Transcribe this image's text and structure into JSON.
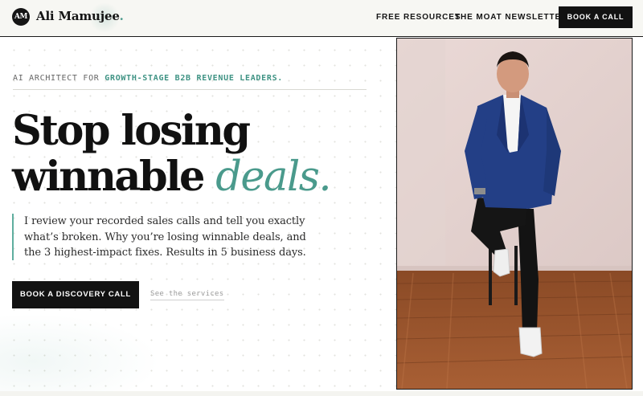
{
  "header": {
    "logo_mark": "AM",
    "logo_name": "Ali Mamujee",
    "logo_dot": ".",
    "nav": {
      "free_resources": "FREE RESOURCES",
      "moat_newsletter": "THE MOAT NEWSLETTER"
    },
    "cta_label": "BOOK A CALL"
  },
  "hero": {
    "eyebrow_prefix": "AI ARCHITECT FOR ",
    "eyebrow_accent": "GROWTH-STAGE B2B REVENUE LEADERS.",
    "headline_line1": "Stop losing",
    "headline_line2_plain": "winnable ",
    "headline_line2_accent": "deals.",
    "lede_lines": [
      "I review your recorded sales calls and tell you exactly",
      "what’s broken. Why you’re losing winnable deals, and",
      "the 3 highest-impact fixes. Results in 5 business days."
    ],
    "primary_cta": "BOOK A DISCOVERY CALL",
    "secondary_link": "See the services"
  },
  "colors": {
    "accent": "#4a9a8c",
    "ink": "#121212",
    "header_bg": "#f7f7f3"
  }
}
